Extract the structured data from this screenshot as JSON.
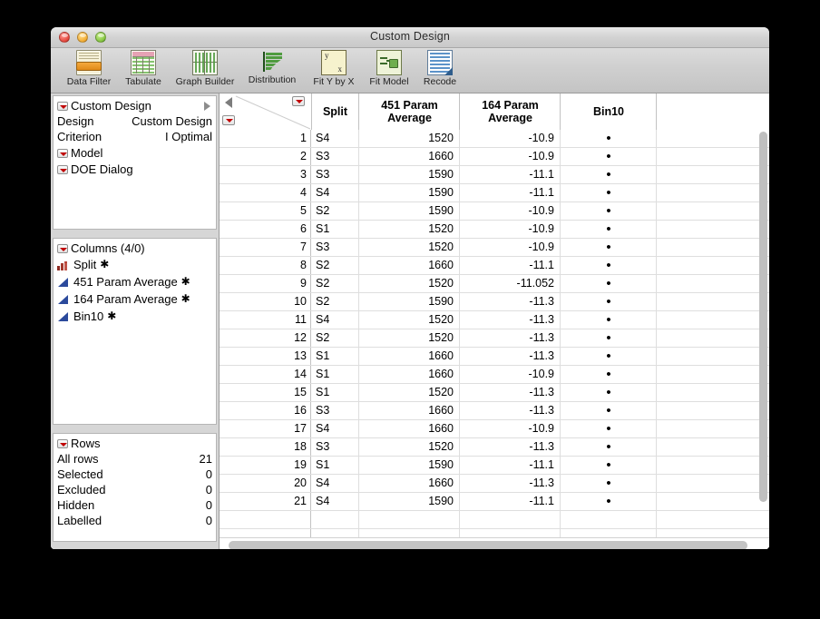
{
  "window": {
    "title": "Custom Design",
    "controls": {
      "close": "close-button",
      "minimize": "minimize-button",
      "zoom": "zoom-button"
    }
  },
  "toolbar": {
    "items": [
      {
        "label": "Data Filter",
        "icon": "data-filter-icon"
      },
      {
        "label": "Tabulate",
        "icon": "tabulate-icon"
      },
      {
        "label": "Graph Builder",
        "icon": "graph-builder-icon"
      },
      {
        "label": "Distribution",
        "icon": "distribution-icon"
      },
      {
        "label": "Fit Y by X",
        "icon": "fit-y-by-x-icon"
      },
      {
        "label": "Fit Model",
        "icon": "fit-model-icon"
      },
      {
        "label": "Recode",
        "icon": "recode-icon"
      }
    ]
  },
  "design_panel": {
    "title": "Custom Design",
    "rows": [
      {
        "key": "Design",
        "value": "Custom Design"
      },
      {
        "key": "Criterion",
        "value": "I Optimal"
      }
    ],
    "sub_items": [
      {
        "label": "Model"
      },
      {
        "label": "DOE Dialog"
      }
    ]
  },
  "columns_panel": {
    "title": "Columns (4/0)",
    "items": [
      {
        "name": "Split",
        "type": "nominal",
        "marker": "✱"
      },
      {
        "name": "451 Param Average",
        "type": "continuous",
        "marker": "✱"
      },
      {
        "name": "164 Param Average",
        "type": "continuous",
        "marker": "✱"
      },
      {
        "name": "Bin10",
        "type": "continuous",
        "marker": "✱"
      }
    ]
  },
  "rows_panel": {
    "title": "Rows",
    "stats": [
      {
        "key": "All rows",
        "value": "21"
      },
      {
        "key": "Selected",
        "value": "0"
      },
      {
        "key": "Excluded",
        "value": "0"
      },
      {
        "key": "Hidden",
        "value": "0"
      },
      {
        "key": "Labelled",
        "value": "0"
      }
    ]
  },
  "table": {
    "columns": [
      {
        "id": "rownum",
        "label": ""
      },
      {
        "id": "split",
        "label": "Split"
      },
      {
        "id": "p451",
        "label": "451 Param\nAverage",
        "line1": "451 Param",
        "line2": "Average"
      },
      {
        "id": "p164",
        "label": "164 Param\nAverage",
        "line1": "164 Param",
        "line2": "Average"
      },
      {
        "id": "bin10",
        "label": "Bin10"
      },
      {
        "id": "extra",
        "label": ""
      }
    ],
    "missing_marker": "•",
    "rows": [
      {
        "n": "1",
        "split": "S4",
        "p451": "1520",
        "p164": "-10.9",
        "bin10": "•"
      },
      {
        "n": "2",
        "split": "S3",
        "p451": "1660",
        "p164": "-10.9",
        "bin10": "•"
      },
      {
        "n": "3",
        "split": "S3",
        "p451": "1590",
        "p164": "-11.1",
        "bin10": "•"
      },
      {
        "n": "4",
        "split": "S4",
        "p451": "1590",
        "p164": "-11.1",
        "bin10": "•"
      },
      {
        "n": "5",
        "split": "S2",
        "p451": "1590",
        "p164": "-10.9",
        "bin10": "•"
      },
      {
        "n": "6",
        "split": "S1",
        "p451": "1520",
        "p164": "-10.9",
        "bin10": "•"
      },
      {
        "n": "7",
        "split": "S3",
        "p451": "1520",
        "p164": "-10.9",
        "bin10": "•"
      },
      {
        "n": "8",
        "split": "S2",
        "p451": "1660",
        "p164": "-11.1",
        "bin10": "•"
      },
      {
        "n": "9",
        "split": "S2",
        "p451": "1520",
        "p164": "-11.052",
        "bin10": "•"
      },
      {
        "n": "10",
        "split": "S2",
        "p451": "1590",
        "p164": "-11.3",
        "bin10": "•"
      },
      {
        "n": "11",
        "split": "S4",
        "p451": "1520",
        "p164": "-11.3",
        "bin10": "•"
      },
      {
        "n": "12",
        "split": "S2",
        "p451": "1520",
        "p164": "-11.3",
        "bin10": "•"
      },
      {
        "n": "13",
        "split": "S1",
        "p451": "1660",
        "p164": "-11.3",
        "bin10": "•"
      },
      {
        "n": "14",
        "split": "S1",
        "p451": "1660",
        "p164": "-10.9",
        "bin10": "•"
      },
      {
        "n": "15",
        "split": "S1",
        "p451": "1520",
        "p164": "-11.3",
        "bin10": "•"
      },
      {
        "n": "16",
        "split": "S3",
        "p451": "1660",
        "p164": "-11.3",
        "bin10": "•"
      },
      {
        "n": "17",
        "split": "S4",
        "p451": "1660",
        "p164": "-10.9",
        "bin10": "•"
      },
      {
        "n": "18",
        "split": "S3",
        "p451": "1520",
        "p164": "-11.3",
        "bin10": "•"
      },
      {
        "n": "19",
        "split": "S1",
        "p451": "1590",
        "p164": "-11.1",
        "bin10": "•"
      },
      {
        "n": "20",
        "split": "S4",
        "p451": "1660",
        "p164": "-11.3",
        "bin10": "•"
      },
      {
        "n": "21",
        "split": "S4",
        "p451": "1590",
        "p164": "-11.1",
        "bin10": "•"
      }
    ]
  },
  "colors": {
    "accent_red": "#c00000",
    "nominal_icon": "#a33a2e",
    "continuous_icon": "#2b4a9c",
    "window_chrome": "#cfcfcf"
  }
}
